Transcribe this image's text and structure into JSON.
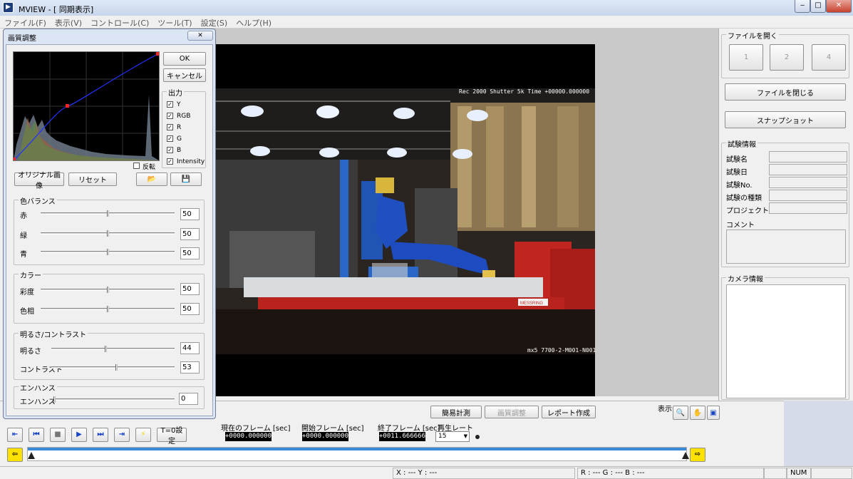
{
  "window": {
    "title": "MVIEW - [ 同期表示]",
    "icon_text": "▶",
    "min_label": "‒",
    "max_label": "□",
    "close_label": "✕"
  },
  "menu": [
    "ファイル(F)",
    "表示(V)",
    "コントロール(C)",
    "ツール(T)",
    "設定(S)",
    "ヘルプ(H)"
  ],
  "video": {
    "osd_top": "Rec  2000  Shutter  5k  Time  +00000.000000",
    "osd_bottom": "mx5 7700-2-M001-N001",
    "banner": "MESSRING"
  },
  "right_panel": {
    "open_file_group": "ファイルを開く",
    "layout_buttons": [
      "1",
      "2",
      "4"
    ],
    "close_file": "ファイルを閉じる",
    "snapshot": "スナップショット",
    "test_info_group": "試験情報",
    "test_fields": [
      "試験名",
      "試験日",
      "試験No.",
      "試験の種類",
      "プロジェクト"
    ],
    "comment_label": "コメント",
    "camera_info_group": "カメラ情報"
  },
  "dialog": {
    "title": "画質調整",
    "close_label": "✕",
    "ok": "OK",
    "cancel": "キャンセル",
    "output_group": "出力",
    "output_items": [
      "Y",
      "RGB",
      "R",
      "G",
      "B",
      "Intensity"
    ],
    "invert": "反転",
    "original_image": "オリジナル画像",
    "reset": "リセット",
    "color_balance_group": "色バランス",
    "color_balance": [
      {
        "label": "赤",
        "value": "50",
        "level": 0.5
      },
      {
        "label": "緑",
        "value": "50",
        "level": 0.5
      },
      {
        "label": "青",
        "value": "50",
        "level": 0.5
      }
    ],
    "color_group": "カラー",
    "color": [
      {
        "label": "彩度",
        "value": "50",
        "level": 0.5
      },
      {
        "label": "色相",
        "value": "50",
        "level": 0.5
      }
    ],
    "bc_group": "明るさ/コントラスト",
    "bc": [
      {
        "label": "明るさ",
        "value": "44",
        "level": 0.44
      },
      {
        "label": "コントラスト",
        "value": "53",
        "level": 0.53
      }
    ],
    "enhance_group": "エンハンス",
    "enhance": [
      {
        "label": "エンハンス",
        "value": "0",
        "level": 0.0
      }
    ]
  },
  "bottom": {
    "simple_measure": "簡易計測",
    "image_adjust": "画質調整",
    "report": "レポート作成",
    "display_label": "表示",
    "t0_button": "T=0設定",
    "current_frame_label": "現在のフレーム [sec]",
    "current_frame_value": "+0000.000000",
    "start_frame_label": "開始フレーム [sec]",
    "start_frame_value": "+0000.000000",
    "end_frame_label": "終了フレーム [sec]",
    "end_frame_value": "+0011.666666",
    "rate_label": "再生レート",
    "rate_value": "15"
  },
  "status": {
    "xy": "X : ---  Y : ---",
    "rgb": "R : ---  G : ---  B : ---",
    "num": "NUM"
  }
}
